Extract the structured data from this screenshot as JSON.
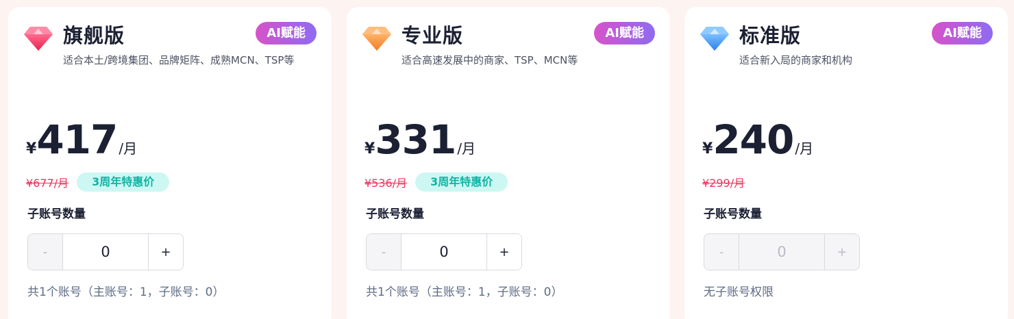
{
  "plans": [
    {
      "name": "旗舰版",
      "badge": "AI赋能",
      "description": "适合本土/跨境集团、品牌矩阵、成熟MCN、TSP等",
      "currency": "¥",
      "price": "417",
      "period": "/月",
      "original_price": "¥677/月",
      "promo_tag": "3周年特惠价",
      "sub_accounts_label": "子账号数量",
      "stepper": {
        "minus": "-",
        "value": "0",
        "plus": "+"
      },
      "note": "共1个账号（主账号：1，子账号：0）",
      "gem_color": "#f0345e"
    },
    {
      "name": "专业版",
      "badge": "AI赋能",
      "description": "适合高速发展中的商家、TSP、MCN等",
      "currency": "¥",
      "price": "331",
      "period": "/月",
      "original_price": "¥536/月",
      "promo_tag": "3周年特惠价",
      "sub_accounts_label": "子账号数量",
      "stepper": {
        "minus": "-",
        "value": "0",
        "plus": "+"
      },
      "note": "共1个账号（主账号：1，子账号：0）",
      "gem_color": "#f7943a"
    },
    {
      "name": "标准版",
      "badge": "AI赋能",
      "description": "适合新入局的商家和机构",
      "currency": "¥",
      "price": "240",
      "period": "/月",
      "original_price": "¥299/月",
      "sub_accounts_label": "子账号数量",
      "stepper": {
        "minus": "-",
        "value": "0",
        "plus": "+"
      },
      "note": "无子账号权限",
      "gem_color": "#3d8ff2"
    }
  ],
  "colors": {
    "badge_gradient_start": "#d653c9",
    "badge_gradient_end": "#8e6bf3",
    "strike_price": "#f0345e",
    "promo_text": "#0fb4a4",
    "promo_bg": "#cdf7f3"
  }
}
